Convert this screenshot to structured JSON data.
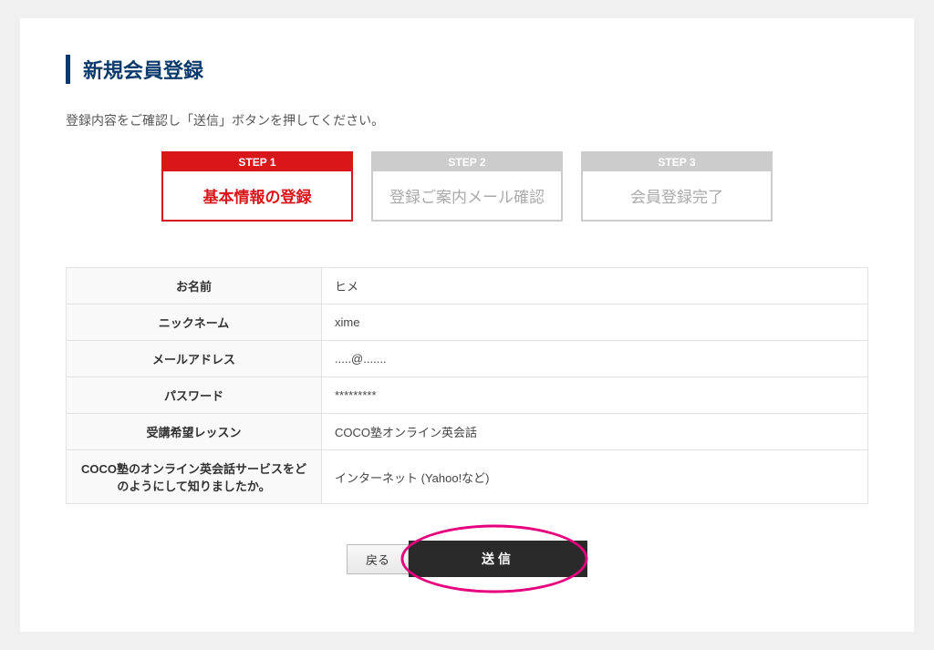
{
  "title": "新規会員登録",
  "instruction": "登録内容をご確認し「送信」ボタンを押してください。",
  "steps": [
    {
      "header": "STEP 1",
      "body": "基本情報の登録"
    },
    {
      "header": "STEP 2",
      "body": "登録ご案内メール確認"
    },
    {
      "header": "STEP 3",
      "body": "会員登録完了"
    }
  ],
  "fields": {
    "name_label": "お名前",
    "name_value": "ヒメ",
    "nickname_label": "ニックネーム",
    "nickname_value": "xime",
    "email_label": "メールアドレス",
    "email_value": ".....@.......",
    "password_label": "パスワード",
    "password_value": "*********",
    "lesson_label": "受講希望レッスン",
    "lesson_value": "COCO塾オンライン英会話",
    "survey_label": "COCO塾のオンライン英会話サービスをどのようにして知りましたか。",
    "survey_value": "インターネット (Yahoo!など)"
  },
  "buttons": {
    "back": "戻る",
    "submit": "送信"
  }
}
